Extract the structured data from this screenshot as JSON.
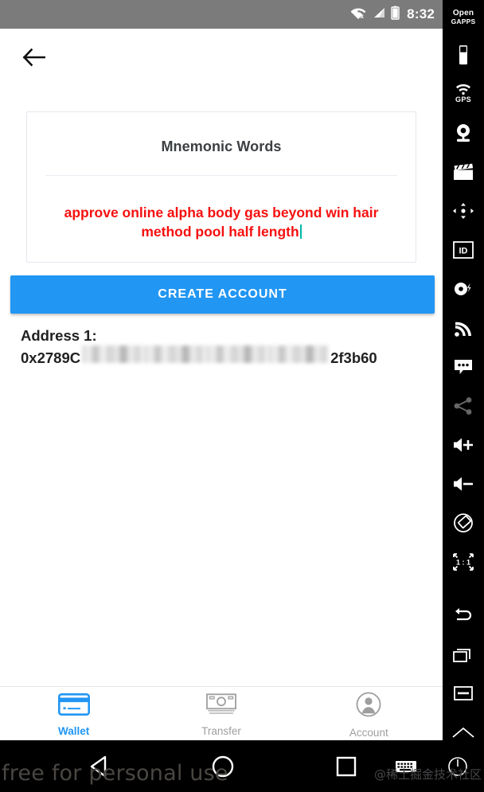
{
  "status_bar": {
    "time": "8:32",
    "wifi_icon": "wifi-off-icon",
    "signal_icon": "cell-signal-icon",
    "battery_icon": "battery-icon",
    "background_color": "#7b7b7b"
  },
  "app_bar": {
    "back_icon": "arrow-back-icon"
  },
  "card": {
    "title": "Mnemonic Words",
    "mnemonic": "approve online alpha body gas beyond win hair method pool half length",
    "text_color": "#f5100f",
    "caret_color": "#00b9a8"
  },
  "actions": {
    "create_account_label": "CREATE ACCOUNT",
    "accent_color": "#2196f3"
  },
  "address": {
    "label": "Address 1:",
    "prefix": "0x2789C",
    "redacted": true,
    "suffix": "2f3b60"
  },
  "bottom_nav": {
    "items": [
      {
        "label": "Wallet",
        "icon": "credit-card-icon",
        "active": true
      },
      {
        "label": "Transfer",
        "icon": "banknote-icon",
        "active": false
      },
      {
        "label": "Account",
        "icon": "person-circle-icon",
        "active": false
      }
    ]
  },
  "system_nav": {
    "back_icon": "triangle-back-icon",
    "home_icon": "circle-home-icon",
    "recent_icon": "square-recents-icon",
    "keyboard_icon": "keyboard-icon",
    "power_icon": "power-icon"
  },
  "side_toolbar": {
    "brand_line1": "Open",
    "brand_line2": "GAPPS",
    "gps_label": "GPS",
    "ratio_label": "1 : 1",
    "items": [
      {
        "name": "phone-icon"
      },
      {
        "name": "gps-icon"
      },
      {
        "name": "webcam-icon"
      },
      {
        "name": "clapperboard-icon"
      },
      {
        "name": "dpad-icon"
      },
      {
        "name": "id-icon"
      },
      {
        "name": "battery-bolt-icon"
      },
      {
        "name": "cellular-icon"
      },
      {
        "name": "message-icon"
      },
      {
        "name": "share-icon"
      },
      {
        "name": "volume-up-icon"
      },
      {
        "name": "volume-down-icon"
      },
      {
        "name": "rotate-icon"
      },
      {
        "name": "zoom-actual-icon"
      },
      {
        "name": "back-arrow-icon"
      },
      {
        "name": "overview-icon"
      },
      {
        "name": "menu-icon"
      },
      {
        "name": "home-icon"
      }
    ]
  },
  "watermarks": {
    "left": "free for personal use",
    "right": "@稀土掘金技术社区"
  }
}
